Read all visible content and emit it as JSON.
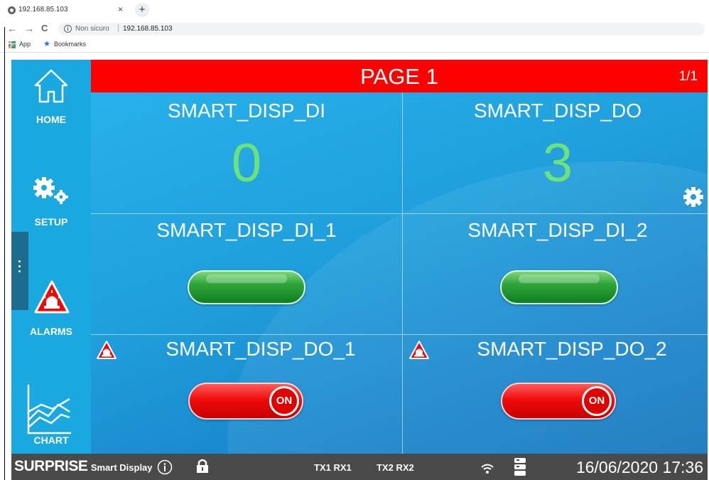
{
  "browser": {
    "tab_title": "192.168.85.103",
    "tab_close": "×",
    "new_tab": "+",
    "back": "←",
    "forward": "→",
    "reload": "C",
    "security_text": "Non sicuro",
    "url": "192.168.85.103",
    "bookmarks": {
      "apps_label": "App",
      "bookmarks_label": "Bookmarks"
    }
  },
  "sidebar": {
    "items": [
      {
        "label": "HOME",
        "icon": "home-icon"
      },
      {
        "label": "SETUP",
        "icon": "gears-icon"
      },
      {
        "label": "ALARMS",
        "icon": "alarm-icon"
      },
      {
        "label": "CHART",
        "icon": "chart-icon"
      }
    ]
  },
  "header": {
    "title": "PAGE 1",
    "page_count": "1/1"
  },
  "cells": [
    {
      "label": "SMART_DISP_DI",
      "value": "0"
    },
    {
      "label": "SMART_DISP_DO",
      "value": "3"
    },
    {
      "label": "SMART_DISP_DI_1",
      "state": "green-indicator"
    },
    {
      "label": "SMART_DISP_DI_2",
      "state": "green-indicator"
    },
    {
      "label": "SMART_DISP_DO_1",
      "toggle": "ON",
      "alarm": true
    },
    {
      "label": "SMART_DISP_DO_2",
      "toggle": "ON",
      "alarm": true
    }
  ],
  "statusbar": {
    "brand_main": "SURPRISE",
    "brand_sub": "Smart Display",
    "tx1rx1": "TX1 RX1",
    "tx2rx2": "TX2 RX2",
    "datetime": "16/06/2020 17:36"
  },
  "colors": {
    "header": "#ff0000",
    "sidebar": "#19a8e0",
    "value_text": "#6ee27a",
    "statusbar": "#4a4a4a",
    "toggle_on": "#f00c0c",
    "indicator": "#2ea53a"
  }
}
